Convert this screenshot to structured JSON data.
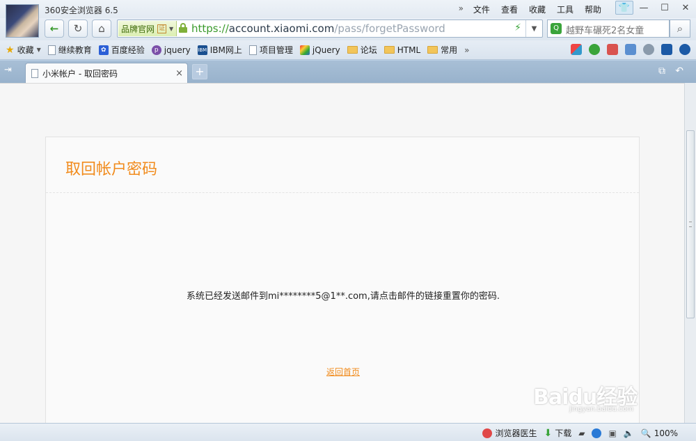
{
  "window": {
    "app_title": "360安全浏览器 6.5",
    "menu": [
      "文件",
      "查看",
      "收藏",
      "工具",
      "帮助"
    ],
    "menu_more": "»"
  },
  "nav": {
    "brand_label": "品牌官网",
    "brand_badge": "证",
    "url_scheme": "https://",
    "url_host": "account.xiaomi.com",
    "url_path": "/pass/forgetPassword",
    "search_text": "越野车碾死2名女童"
  },
  "bookmarks": [
    {
      "label": "收藏",
      "icon": "star-icon"
    },
    {
      "label": "继续教育",
      "icon": "page-icon"
    },
    {
      "label": "百度经验",
      "icon": "baidu-icon"
    },
    {
      "label": "jquery",
      "icon": "php-icon"
    },
    {
      "label": "IBM网上",
      "icon": "ibm-icon"
    },
    {
      "label": "项目管理",
      "icon": "page-icon"
    },
    {
      "label": "jQuery",
      "icon": "jquery-icon"
    },
    {
      "label": "论坛",
      "icon": "folder-icon"
    },
    {
      "label": "HTML",
      "icon": "folder-icon"
    },
    {
      "label": "常用",
      "icon": "folder-icon"
    }
  ],
  "bookmarks_more": "»",
  "tab": {
    "title": "小米帐户 - 取回密码",
    "close": "×",
    "new": "+"
  },
  "page": {
    "heading": "取回帐户密码",
    "message": "系统已经发送邮件到mi********5@1**.com,请点击邮件的链接重置你的密码.",
    "home_link": "返回首页"
  },
  "status": {
    "doctor": "浏览器医生",
    "download": "下载",
    "zoom": "100%"
  },
  "watermark": {
    "brand": "Baidu经验",
    "sub": "jingyan.baidu.com"
  },
  "colors": {
    "accent_orange": "#f18b1c",
    "url_green": "#3a9a2c",
    "tab_strip": "#a8bfd6"
  }
}
